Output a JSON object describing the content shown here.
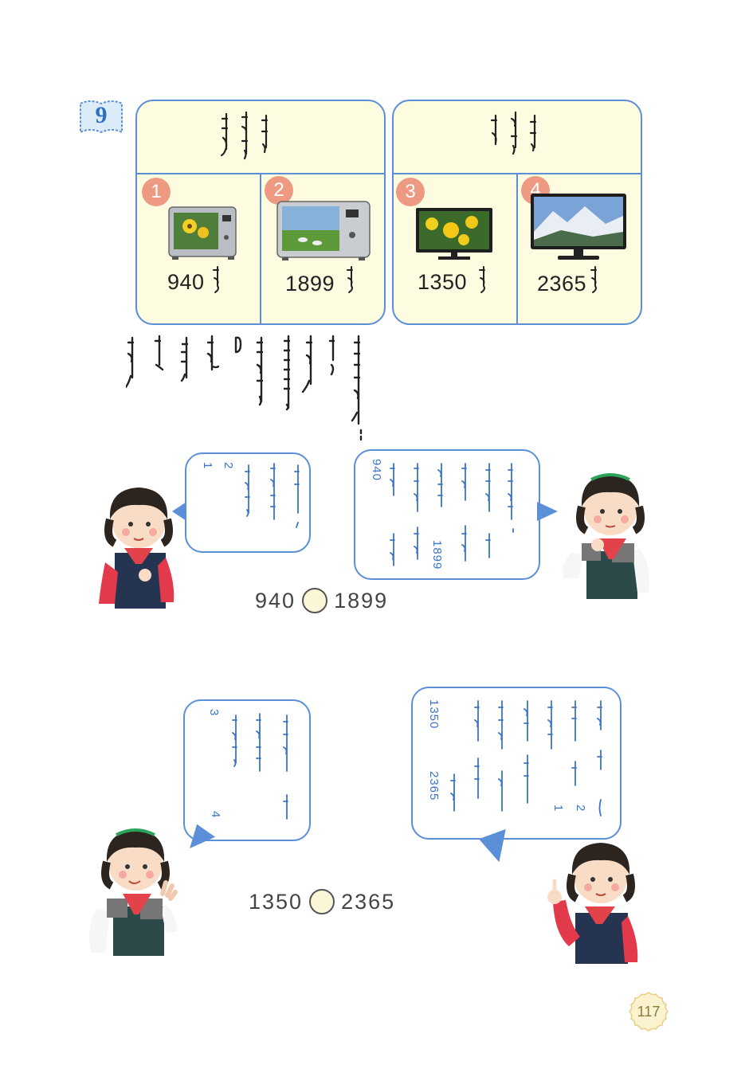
{
  "exercise": {
    "number": "9"
  },
  "panels": [
    {
      "items": [
        {
          "badge": "1",
          "price": "940"
        },
        {
          "badge": "2",
          "price": "1899"
        }
      ]
    },
    {
      "items": [
        {
          "badge": "3",
          "price": "1350"
        },
        {
          "badge": "4",
          "price": "2365"
        }
      ]
    }
  ],
  "dialogs": {
    "top_left_numbers": [
      "1",
      "2"
    ],
    "top_right_numbers": [
      "940",
      "1899"
    ],
    "top_compare": {
      "left": "940",
      "right": "1899"
    },
    "bottom_left_numbers": [
      "3",
      "4"
    ],
    "bottom_right_numbers": [
      "1350",
      "2365",
      "2",
      "1"
    ],
    "bottom_compare": {
      "left": "1350",
      "right": "2365"
    }
  },
  "page_number": "117",
  "colors": {
    "accent": "#5b8fd8",
    "panel_bg": "#fdfbe0",
    "badge": "#ee9a82",
    "script": "#3a74c9"
  }
}
